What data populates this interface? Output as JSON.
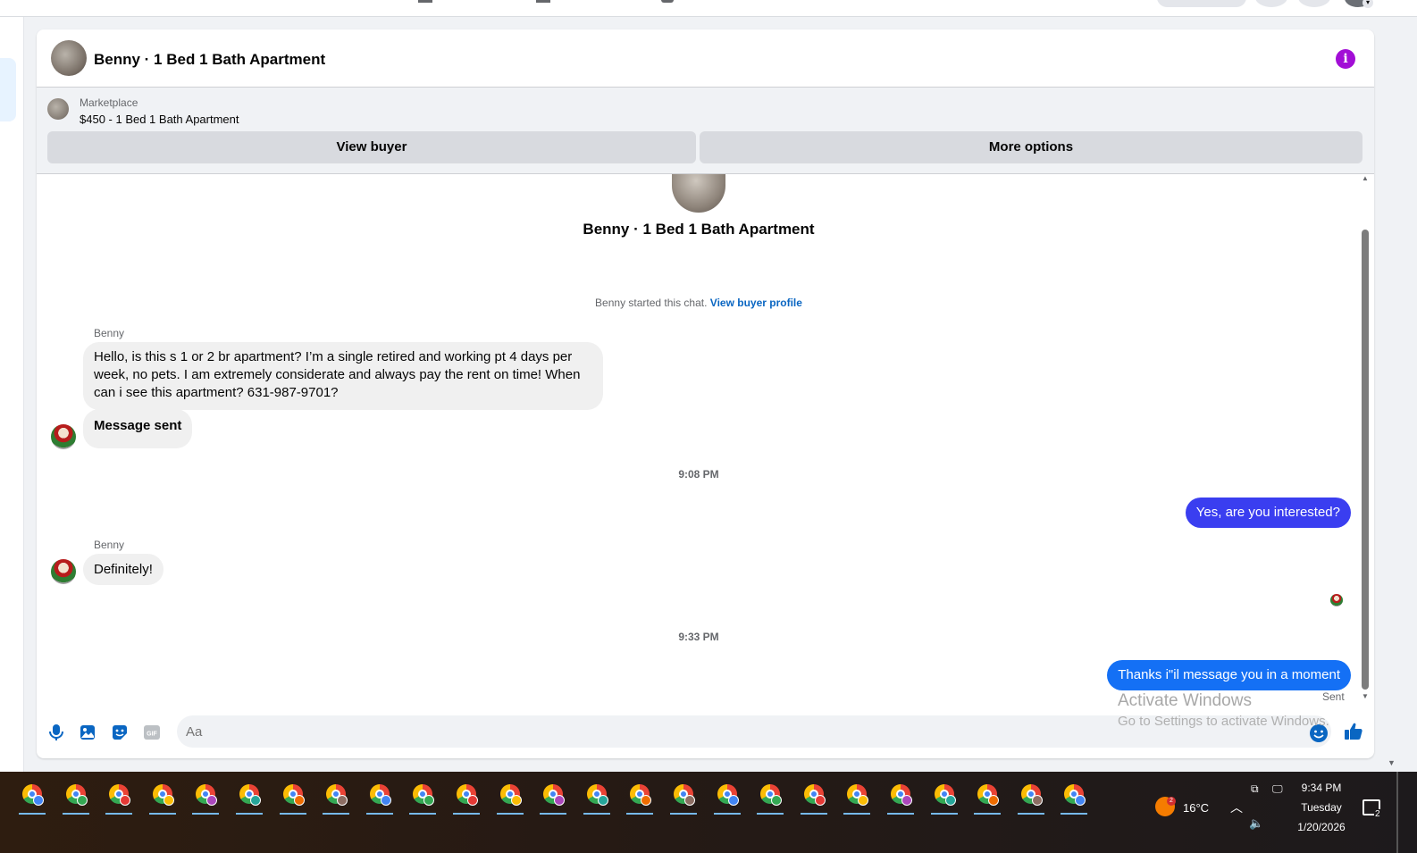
{
  "header": {
    "title": "Benny · 1 Bed 1 Bath Apartment"
  },
  "marketplace": {
    "source": "Marketplace",
    "listing": "$450 - 1 Bed 1 Bath Apartment",
    "view_buyer_label": "View buyer",
    "more_options_label": "More options"
  },
  "thread": {
    "title": "Benny · 1 Bed 1 Bath Apartment",
    "started_text": "Benny started this chat.",
    "view_profile_link": "View buyer profile",
    "messages": [
      {
        "sender": "Benny",
        "text": "Hello, is this s 1 or 2 br apartment? I’m a single retired and working pt 4 days per week, no pets. I am extremely considerate and always pay the rent on time! When can i see this apartment? 631-987-9701?"
      },
      {
        "text": "Message sent"
      },
      {
        "timestamp": "9:08 PM"
      },
      {
        "outgoing": true,
        "text": "Yes, are you interested?"
      },
      {
        "sender": "Benny",
        "text": "Definitely!"
      },
      {
        "timestamp": "9:33 PM"
      },
      {
        "outgoing": true,
        "text": "Thanks i\"il message you in a moment",
        "status": "Sent"
      }
    ],
    "outgoing_colors": [
      "#3a3ef0",
      "#1470f5"
    ]
  },
  "composer": {
    "placeholder": "Aa",
    "icons": [
      "microphone-icon",
      "photo-icon",
      "sticker-icon",
      "gif-icon",
      "emoji-icon",
      "thumbs-up-icon"
    ]
  },
  "watermark": {
    "title": "Activate Windows",
    "subtitle": "Go to Settings to activate Windows."
  },
  "taskbar": {
    "app_count": 25,
    "weather_badge": "2",
    "temperature": "16°C",
    "time": "9:34 PM",
    "day": "Tuesday",
    "date": "1/20/2026",
    "notification_count": "2"
  },
  "colors": {
    "accent": "#0a66c2",
    "info": "#a20ed6",
    "messenger_blue": "#0084ff"
  }
}
